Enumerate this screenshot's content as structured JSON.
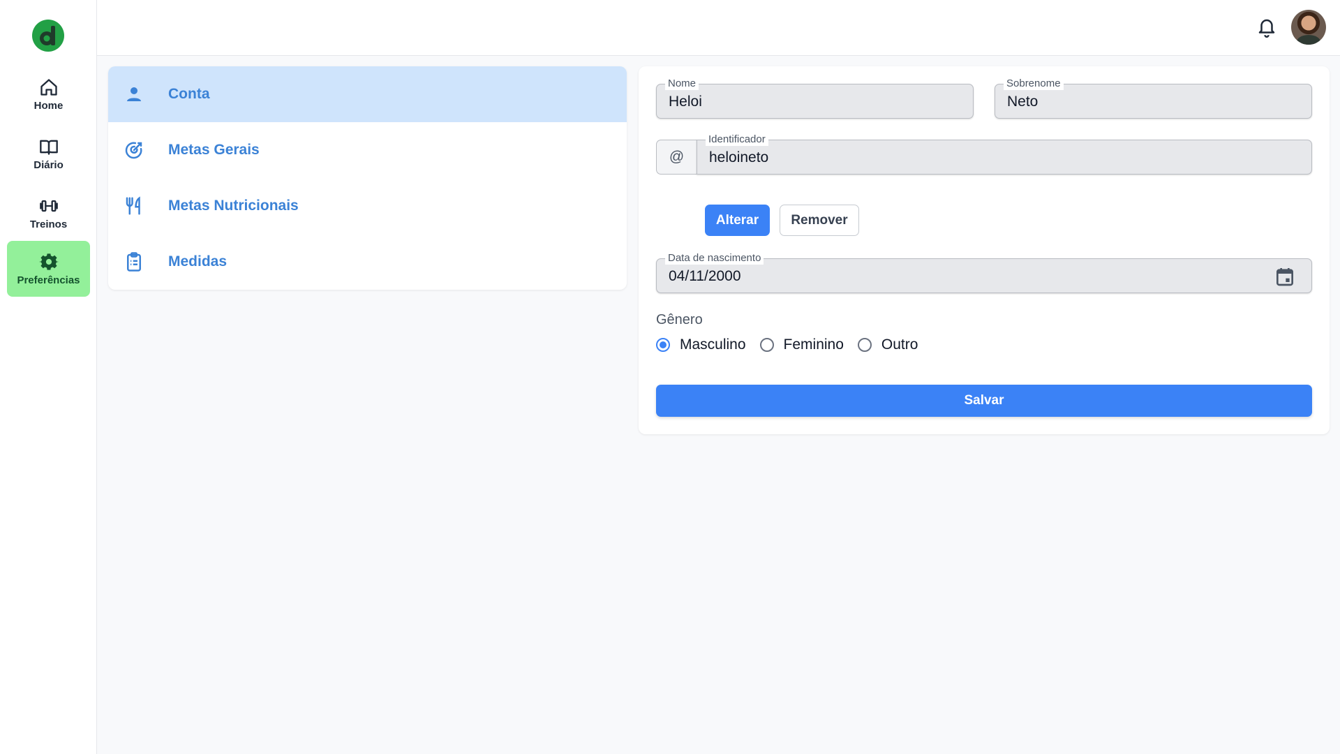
{
  "nav": {
    "items": [
      {
        "label": "Home",
        "icon": "home-icon"
      },
      {
        "label": "Diário",
        "icon": "book-icon"
      },
      {
        "label": "Treinos",
        "icon": "dumbbell-icon"
      },
      {
        "label": "Preferências",
        "icon": "gear-icon",
        "active": true
      }
    ]
  },
  "topbar": {
    "bell_icon": "bell-icon",
    "avatar_icon": "user-avatar"
  },
  "settings_menu": {
    "items": [
      {
        "label": "Conta",
        "icon": "person-icon",
        "active": true
      },
      {
        "label": "Metas Gerais",
        "icon": "target-icon"
      },
      {
        "label": "Metas Nutricionais",
        "icon": "fork-knife-icon"
      },
      {
        "label": "Medidas",
        "icon": "clipboard-icon"
      }
    ]
  },
  "form": {
    "nome": {
      "label": "Nome",
      "value": "Heloi"
    },
    "sobrenome": {
      "label": "Sobrenome",
      "value": "Neto"
    },
    "identificador": {
      "prefix": "@",
      "label": "Identificador",
      "value": "heloineto"
    },
    "buttons": {
      "alterar": "Alterar",
      "remover": "Remover",
      "salvar": "Salvar"
    },
    "nascimento": {
      "label": "Data de nascimento",
      "value": "04/11/2000"
    },
    "genero": {
      "label": "Gênero",
      "options": [
        "Masculino",
        "Feminino",
        "Outro"
      ],
      "selected": "Masculino"
    }
  },
  "colors": {
    "accent": "#3b82f6",
    "nav_active_bg": "#93f09a",
    "menu_active_bg": "#cfe4fc",
    "menu_text": "#3b82d6",
    "logo_green": "#22a045"
  }
}
